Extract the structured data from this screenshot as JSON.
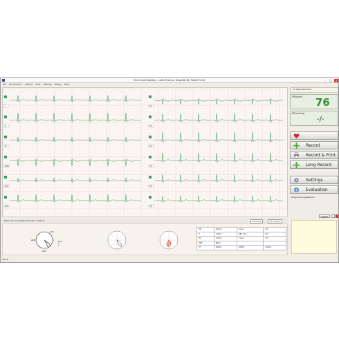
{
  "window": {
    "title": "ECG Examination - Ludd Francis, Hospital ID, Patient's ID",
    "close": "x",
    "minimize": "_",
    "maximize": "□"
  },
  "menu": [
    "File",
    "Examination",
    "Indexes",
    "View",
    "Settings",
    "Design",
    "Help"
  ],
  "leads_left": [
    "I",
    "II",
    "III",
    "aVR",
    "aVL",
    "aVF"
  ],
  "leads_right": [
    "V1",
    "V2",
    "V3",
    "V4",
    "V5",
    "V6"
  ],
  "filter_status": "Filter: Auto 0.07 Jatrex (90 Aabd, 25 Bms)",
  "speed": "25 mm/s",
  "gain": "10 mm/mV",
  "right_panel": {
    "leads_label": "12 leads standard",
    "hr_label": "HR[bpm]",
    "hr_value": "76",
    "bp_label": "BP[mmHg]",
    "bp_value": "-/-",
    "record": "Record",
    "record_print": "Record & Print",
    "long_record": "Long Record",
    "settings": "Settings",
    "evaluation": "Evaluation",
    "diagnosis_label": "Diagnosis suggestions:",
    "bottom_btn": "suggest."
  },
  "measurements": [
    [
      "HR",
      "76/min",
      "P axis",
      "40°"
    ],
    [
      "P",
      "116ms",
      "QRS axis",
      "60°"
    ],
    [
      "PQ",
      "154ms",
      "T axis",
      "30°"
    ],
    [
      "QRS",
      "98ms",
      "",
      ""
    ],
    [
      "QT",
      "360ms",
      "QTc(B)",
      "443ms"
    ]
  ],
  "vector_labels": [
    "aVR",
    "aVL",
    "I",
    "aVF",
    "II",
    "III"
  ],
  "legend": [
    "QRS",
    "P",
    "T"
  ],
  "statusbar": "Ready",
  "colors": {
    "trace": "#3a9e5a",
    "hr": "#2f8f3a",
    "record_icon": "#4fa83a",
    "heart": "#d42a2a"
  }
}
